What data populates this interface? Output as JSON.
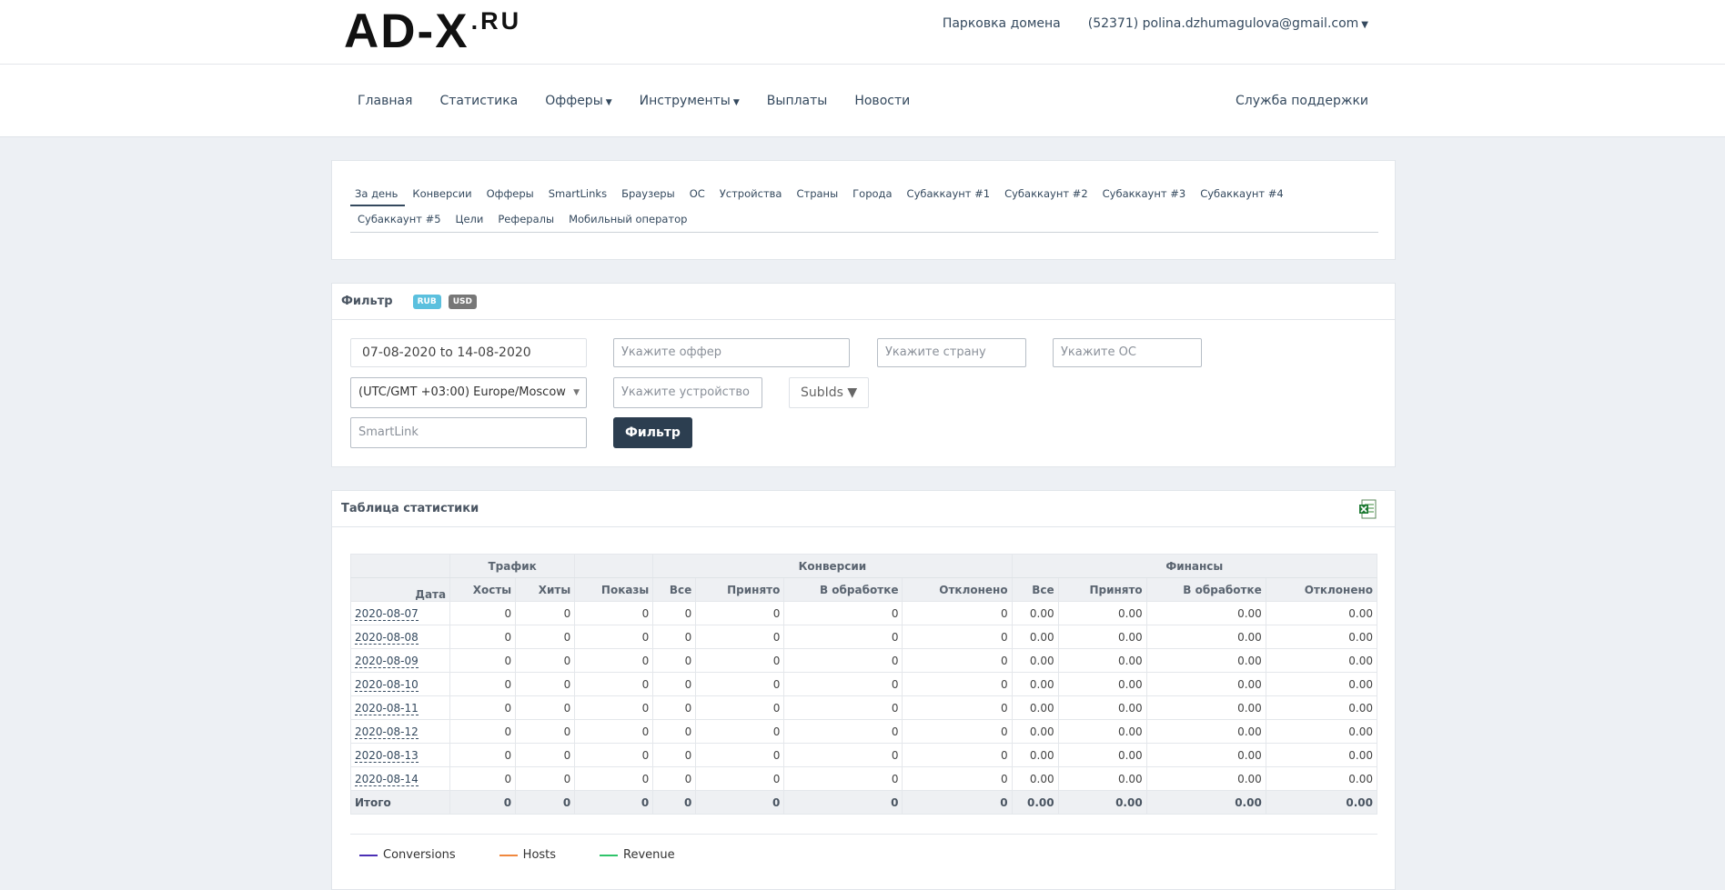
{
  "brand": {
    "main": "AD-X",
    "suffix": ".RU"
  },
  "top_links": {
    "parking": "Парковка домена",
    "account": "(52371) polina.dzhumagulova@gmail.com"
  },
  "nav": {
    "items": [
      "Главная",
      "Статистика",
      "Офферы",
      "Инструменты",
      "Выплаты",
      "Новости"
    ],
    "support": "Служба поддержки"
  },
  "tabs": [
    "За день",
    "Конверсии",
    "Офферы",
    "SmartLinks",
    "Браузеры",
    "ОС",
    "Устройства",
    "Страны",
    "Города",
    "Субаккаунт #1",
    "Субаккаунт #2",
    "Субаккаунт #3",
    "Субаккаунт #4",
    "Субаккаунт #5",
    "Цели",
    "Рефералы",
    "Мобильный оператор"
  ],
  "filter": {
    "title": "Фильтр",
    "badges": {
      "rub": "RUB",
      "usd": "USD"
    },
    "date_range": "07-08-2020 to 14-08-2020",
    "offer_placeholder": "Укажите оффер",
    "country_placeholder": "Укажите страну",
    "os_placeholder": "Укажите ОС",
    "timezone": "(UTC/GMT +03:00) Europe/Moscow",
    "device_placeholder": "Укажите устройство",
    "subids": "SubIds ▼",
    "smartlink_placeholder": "SmartLink",
    "button": "Фильтр"
  },
  "stats": {
    "title": "Таблица статистики",
    "groups": {
      "traffic": "Трафик",
      "conversions": "Конверсии",
      "finance": "Финансы"
    },
    "columns": [
      "Дата",
      "Хосты",
      "Хиты",
      "Показы",
      "Все",
      "Принято",
      "В обработке",
      "Отклонено",
      "Все",
      "Принято",
      "В обработке",
      "Отклонено"
    ],
    "rows": [
      [
        "2020-08-07",
        "0",
        "0",
        "0",
        "0",
        "0",
        "0",
        "0",
        "0.00",
        "0.00",
        "0.00",
        "0.00"
      ],
      [
        "2020-08-08",
        "0",
        "0",
        "0",
        "0",
        "0",
        "0",
        "0",
        "0.00",
        "0.00",
        "0.00",
        "0.00"
      ],
      [
        "2020-08-09",
        "0",
        "0",
        "0",
        "0",
        "0",
        "0",
        "0",
        "0.00",
        "0.00",
        "0.00",
        "0.00"
      ],
      [
        "2020-08-10",
        "0",
        "0",
        "0",
        "0",
        "0",
        "0",
        "0",
        "0.00",
        "0.00",
        "0.00",
        "0.00"
      ],
      [
        "2020-08-11",
        "0",
        "0",
        "0",
        "0",
        "0",
        "0",
        "0",
        "0.00",
        "0.00",
        "0.00",
        "0.00"
      ],
      [
        "2020-08-12",
        "0",
        "0",
        "0",
        "0",
        "0",
        "0",
        "0",
        "0.00",
        "0.00",
        "0.00",
        "0.00"
      ],
      [
        "2020-08-13",
        "0",
        "0",
        "0",
        "0",
        "0",
        "0",
        "0",
        "0.00",
        "0.00",
        "0.00",
        "0.00"
      ],
      [
        "2020-08-14",
        "0",
        "0",
        "0",
        "0",
        "0",
        "0",
        "0",
        "0.00",
        "0.00",
        "0.00",
        "0.00"
      ]
    ],
    "total": [
      "Итого",
      "0",
      "0",
      "0",
      "0",
      "0",
      "0",
      "0",
      "0.00",
      "0.00",
      "0.00",
      "0.00"
    ]
  },
  "legend": [
    {
      "label": "Conversions",
      "color": "#4b2fb5"
    },
    {
      "label": "Hosts",
      "color": "#f0883e"
    },
    {
      "label": "Revenue",
      "color": "#2fc46a"
    }
  ]
}
